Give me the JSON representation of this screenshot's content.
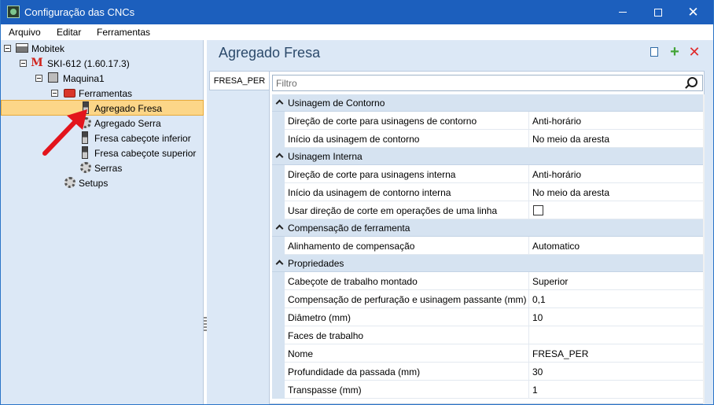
{
  "window": {
    "title": "Configuração das CNCs",
    "close_glyph": "✕"
  },
  "menu": [
    "Arquivo",
    "Editar",
    "Ferramentas"
  ],
  "tree": [
    {
      "label": "Mobitek",
      "icon": "factory-icon"
    },
    {
      "label": "SKI-612 (1.60.17.3)",
      "icon": "brand-m-icon",
      "icon_text": "M"
    },
    {
      "label": "Maquina1",
      "icon": "machine-icon"
    },
    {
      "label": "Ferramentas",
      "icon": "toolbox-icon"
    },
    {
      "label": "Agregado Fresa",
      "icon": "cutter-icon",
      "selected": true
    },
    {
      "label": "Agregado Serra",
      "icon": "saw-gear-icon"
    },
    {
      "label": "Fresa cabeçote inferior",
      "icon": "cutter-icon"
    },
    {
      "label": "Fresa cabeçote superior",
      "icon": "cutter-icon"
    },
    {
      "label": "Serras",
      "icon": "gear-icon"
    },
    {
      "label": "Setups",
      "icon": "gear-icon"
    }
  ],
  "main": {
    "title": "Agregado Fresa",
    "toolbar": {
      "plus_glyph": "+",
      "delete_glyph": "✕"
    },
    "tab_label": "FRESA_PER",
    "filter_placeholder": "Filtro"
  },
  "properties": [
    {
      "category": "Usinagem de Contorno",
      "rows": [
        {
          "name": "Direção de corte para usinagens de contorno",
          "value": "Anti-horário"
        },
        {
          "name": "Início da usinagem de contorno",
          "value": "No meio da aresta"
        }
      ]
    },
    {
      "category": "Usinagem Interna",
      "rows": [
        {
          "name": "Direção de corte para usinagens interna",
          "value": "Anti-horário"
        },
        {
          "name": "Início da usinagem de contorno interna",
          "value": "No meio da aresta"
        },
        {
          "name": "Usar direção de corte em operações de uma linha",
          "value": "",
          "checkbox": true,
          "checked": false
        }
      ]
    },
    {
      "category": "Compensação de ferramenta",
      "rows": [
        {
          "name": "Alinhamento de compensação",
          "value": "Automatico"
        }
      ]
    },
    {
      "category": "Propriedades",
      "rows": [
        {
          "name": "Cabeçote de trabalho montado",
          "value": "Superior"
        },
        {
          "name": "Compensação de perfuração e usinagem passante (mm)",
          "value": "0,1"
        },
        {
          "name": "Diâmetro (mm)",
          "value": "10"
        },
        {
          "name": "Faces de trabalho",
          "value": ""
        },
        {
          "name": "Nome",
          "value": "FRESA_PER"
        },
        {
          "name": "Profundidade da passada (mm)",
          "value": "30"
        },
        {
          "name": "Transpasse (mm)",
          "value": "1"
        }
      ]
    }
  ],
  "colors": {
    "titlebar": "#1c5fbd",
    "panel": "#dce8f6",
    "selection": "#fcd688",
    "annotation_arrow": "#e3141c"
  }
}
